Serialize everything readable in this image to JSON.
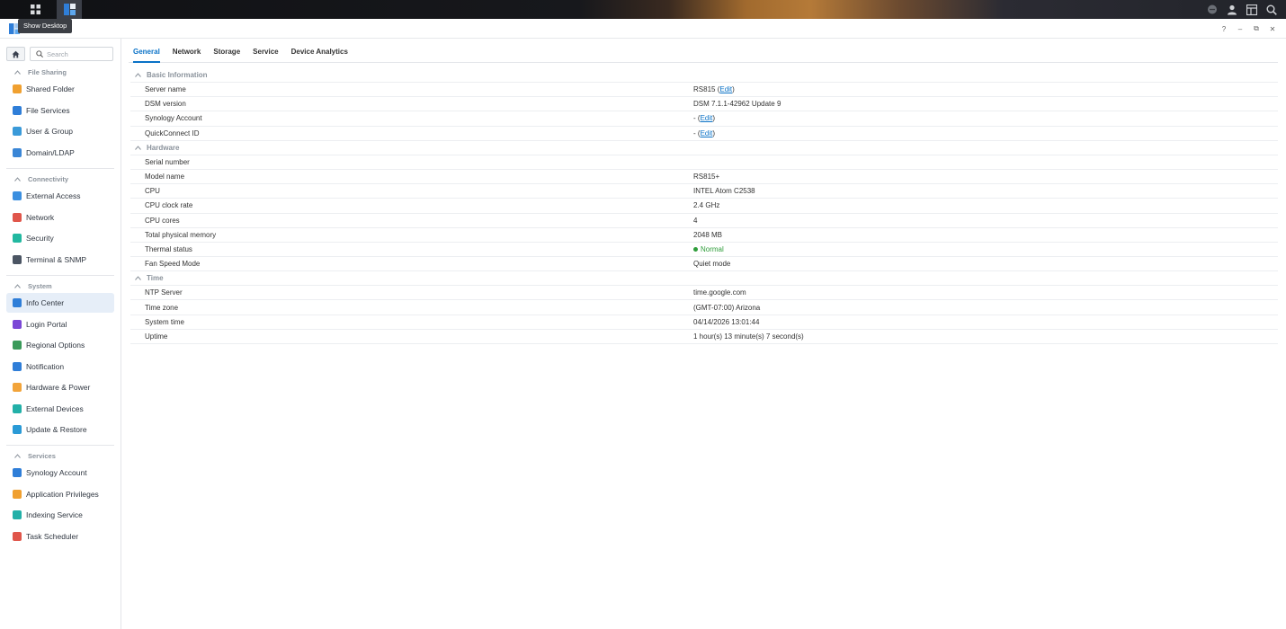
{
  "taskbar": {
    "tooltip": "Show Desktop"
  },
  "window": {
    "controls": [
      "?",
      "–",
      "⧉",
      "✕"
    ]
  },
  "search": {
    "placeholder": "Search"
  },
  "sidebar": {
    "sections": [
      {
        "title": "File Sharing",
        "items": [
          {
            "label": "Shared Folder",
            "color": "#f0a030"
          },
          {
            "label": "File Services",
            "color": "#2f7ed8"
          },
          {
            "label": "User & Group",
            "color": "#3a9ad9"
          },
          {
            "label": "Domain/LDAP",
            "color": "#3a86d6"
          }
        ]
      },
      {
        "title": "Connectivity",
        "items": [
          {
            "label": "External Access",
            "color": "#3b8fe0"
          },
          {
            "label": "Network",
            "color": "#e0564b"
          },
          {
            "label": "Security",
            "color": "#22b8a0"
          },
          {
            "label": "Terminal & SNMP",
            "color": "#4b5563"
          }
        ]
      },
      {
        "title": "System",
        "items": [
          {
            "label": "Info Center",
            "color": "#2f7ed8",
            "active": true
          },
          {
            "label": "Login Portal",
            "color": "#7b48d6"
          },
          {
            "label": "Regional Options",
            "color": "#3a9a5a"
          },
          {
            "label": "Notification",
            "color": "#2f7ed8"
          },
          {
            "label": "Hardware & Power",
            "color": "#f2a43a"
          },
          {
            "label": "External Devices",
            "color": "#22b0a8"
          },
          {
            "label": "Update & Restore",
            "color": "#2a9ad6"
          }
        ]
      },
      {
        "title": "Services",
        "items": [
          {
            "label": "Synology Account",
            "color": "#2f7ed8"
          },
          {
            "label": "Application Privileges",
            "color": "#f0a030"
          },
          {
            "label": "Indexing Service",
            "color": "#22b0a8"
          },
          {
            "label": "Task Scheduler",
            "color": "#e0564b"
          }
        ]
      }
    ]
  },
  "tabs": [
    "General",
    "Network",
    "Storage",
    "Service",
    "Device Analytics"
  ],
  "groups": [
    {
      "title": "Basic Information",
      "rows": [
        {
          "key": "Server name",
          "value": "RS815",
          "link": "Edit"
        },
        {
          "key": "DSM version",
          "value": "DSM 7.1.1-42962 Update 9"
        },
        {
          "key": "Synology Account",
          "value": "-",
          "link": "Edit"
        },
        {
          "key": "QuickConnect ID",
          "value": "-",
          "link": "Edit"
        }
      ]
    },
    {
      "title": "Hardware",
      "rows": [
        {
          "key": "Serial number",
          "value": ""
        },
        {
          "key": "Model name",
          "value": "RS815+"
        },
        {
          "key": "CPU",
          "value": "INTEL Atom C2538"
        },
        {
          "key": "CPU clock rate",
          "value": "2.4 GHz"
        },
        {
          "key": "CPU cores",
          "value": "4"
        },
        {
          "key": "Total physical memory",
          "value": "2048 MB"
        },
        {
          "key": "Thermal status",
          "value": "Normal",
          "status": "ok"
        },
        {
          "key": "Fan Speed Mode",
          "value": "Quiet mode"
        }
      ]
    },
    {
      "title": "Time",
      "rows": [
        {
          "key": "NTP Server",
          "value": "time.google.com"
        },
        {
          "key": "Time zone",
          "value": "(GMT-07:00) Arizona"
        },
        {
          "key": "System time",
          "value": "04/14/2026 13:01:44"
        },
        {
          "key": "Uptime",
          "value": "1 hour(s) 13 minute(s) 7 second(s)"
        }
      ]
    }
  ],
  "colors": {
    "accent": "#0a72c7",
    "ok": "#2e9d3a"
  }
}
